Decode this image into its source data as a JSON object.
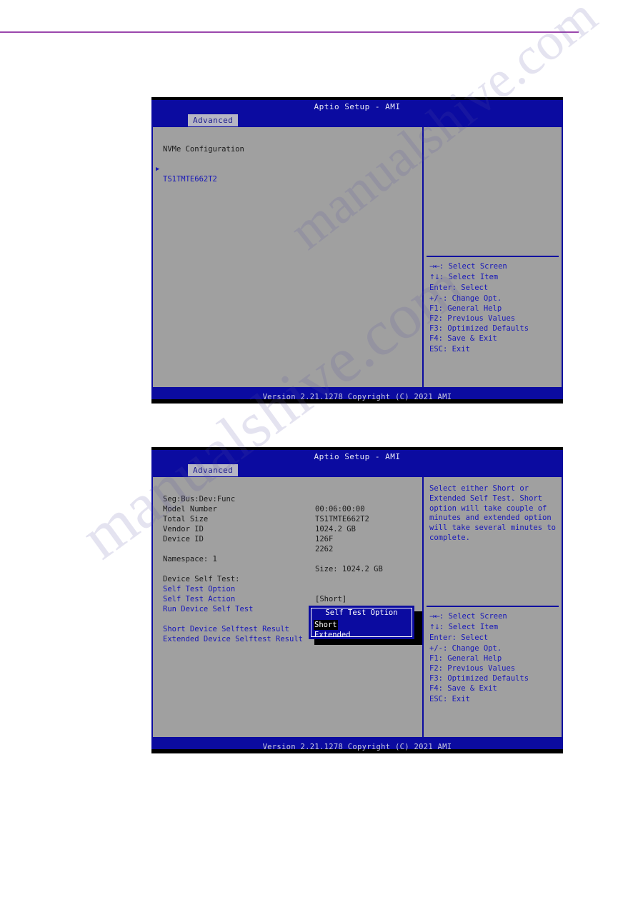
{
  "page": {
    "rule_color": "#9b47ad",
    "watermark_text_1": "manualshive.com",
    "watermark_text_2": "manualshive.com"
  },
  "colors": {
    "bios_blue": "#0b0ba0",
    "bios_gray": "#a0a0a0",
    "text_blue": "#1717b8",
    "text_dark": "#1b1b1b",
    "tab_bg": "#b6b6c4"
  },
  "screen1": {
    "title": "Aptio Setup - AMI",
    "tab": "Advanced",
    "heading": "NVMe Configuration",
    "device_marker": "▶",
    "device_label": "TS1TMTE662T2",
    "help_divider": true,
    "keys": [
      {
        "glyph": "→←",
        "text": ": Select Screen"
      },
      {
        "glyph": "↑↓",
        "text": ": Select Item"
      },
      {
        "glyph": "",
        "text": "Enter: Select"
      },
      {
        "glyph": "",
        "text": "+/-: Change Opt."
      },
      {
        "glyph": "",
        "text": "F1: General Help"
      },
      {
        "glyph": "",
        "text": "F2: Previous Values"
      },
      {
        "glyph": "",
        "text": "F3: Optimized Defaults"
      },
      {
        "glyph": "",
        "text": "F4: Save & Exit"
      },
      {
        "glyph": "",
        "text": "ESC: Exit"
      }
    ],
    "footer": "Version 2.21.1278 Copyright (C) 2021 AMI"
  },
  "screen2": {
    "title": "Aptio Setup - AMI",
    "tab": "Advanced",
    "info_rows": [
      {
        "label": "Seg:Bus:Dev:Func",
        "value": "00:06:00:00"
      },
      {
        "label": "Model Number",
        "value": "TS1TMTE662T2"
      },
      {
        "label": "Total Size",
        "value": "1024.2 GB"
      },
      {
        "label": "Vendor ID",
        "value": "126F"
      },
      {
        "label": "Device ID",
        "value": "2262"
      }
    ],
    "namespace_label": "Namespace: 1",
    "namespace_size": "Size: 1024.2 GB",
    "selftest_heading": "Device Self Test:",
    "selftest_items": [
      {
        "label": "Self Test Option",
        "value": "[Short]"
      },
      {
        "label": "Self Test Action",
        "value": ""
      },
      {
        "label": "Run Device Self Test",
        "value": ""
      }
    ],
    "result_rows": [
      "Short Device Selftest Result",
      "Extended Device Selftest Result"
    ],
    "popup": {
      "title": "Self Test Option",
      "options": [
        {
          "label": "Short",
          "selected": true
        },
        {
          "label": "Extended",
          "selected": false
        }
      ]
    },
    "help_paragraph": [
      "Select either Short or",
      "Extended Self Test. Short",
      "option will take couple of",
      "minutes and extended option",
      "will take several minutes to",
      "complete."
    ],
    "keys": [
      {
        "glyph": "→←",
        "text": ": Select Screen"
      },
      {
        "glyph": "↑↓",
        "text": ": Select Item"
      },
      {
        "glyph": "",
        "text": "Enter: Select"
      },
      {
        "glyph": "",
        "text": "+/-: Change Opt."
      },
      {
        "glyph": "",
        "text": "F1: General Help"
      },
      {
        "glyph": "",
        "text": "F2: Previous Values"
      },
      {
        "glyph": "",
        "text": "F3: Optimized Defaults"
      },
      {
        "glyph": "",
        "text": "F4: Save & Exit"
      },
      {
        "glyph": "",
        "text": "ESC: Exit"
      }
    ],
    "footer": "Version 2.21.1278 Copyright (C) 2021 AMI"
  }
}
